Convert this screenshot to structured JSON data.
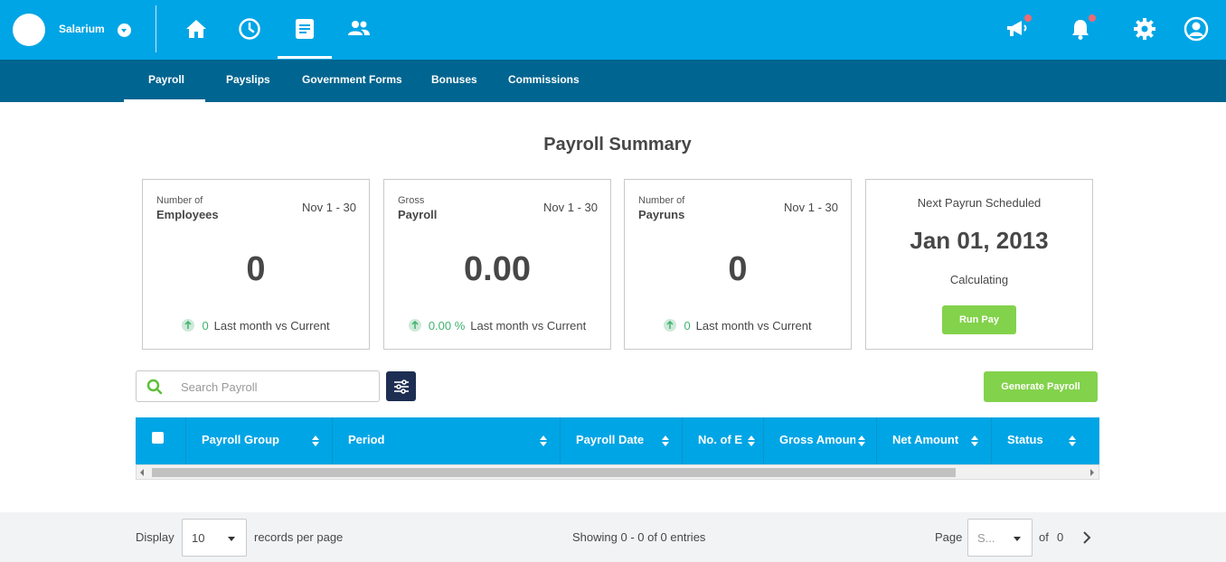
{
  "header": {
    "company_name": "Salarium",
    "nav_icons": [
      "home-icon",
      "clock-icon",
      "document-icon",
      "people-icon"
    ],
    "right_icons": [
      "megaphone-icon",
      "bell-icon",
      "gear-icon",
      "user-icon"
    ],
    "colors": {
      "primary": "#00a5e5",
      "secondary": "#006590",
      "accent_green": "#83d24b",
      "notification": "#ef6a73",
      "dark": "#1d2e52"
    }
  },
  "tabs": [
    {
      "label": "Payroll",
      "active": true
    },
    {
      "label": "Payslips"
    },
    {
      "label": "Government Forms"
    },
    {
      "label": "Bonuses"
    },
    {
      "label": "Commissions"
    }
  ],
  "page_title": "Payroll Summary",
  "cards": [
    {
      "small": "Number of",
      "label": "Employees",
      "range": "Nov 1 - 30",
      "value": "0",
      "change": "0",
      "footer": "Last month vs Current"
    },
    {
      "small": "Gross",
      "label": "Payroll",
      "range": "Nov 1 - 30",
      "value": "0.00",
      "change": "0.00 %",
      "footer": "Last month vs Current"
    },
    {
      "small": "Number of",
      "label": "Payruns",
      "range": "Nov 1 - 30",
      "value": "0",
      "change": "0",
      "footer": "Last month vs Current"
    }
  ],
  "next_payrun": {
    "title": "Next Payrun Scheduled",
    "date": "Jan 01, 2013",
    "status": "Calculating",
    "button": "Run Pay"
  },
  "search": {
    "placeholder": "Search Payroll"
  },
  "generate_button": "Generate Payroll",
  "table": {
    "columns": [
      "Payroll Group",
      "Period",
      "Payroll Date",
      "No. of E",
      "Gross Amoun",
      "Net Amount",
      "Status"
    ]
  },
  "footer": {
    "display_label": "Display",
    "page_size": "10",
    "records_label": "records per page",
    "showing": "Showing 0 - 0 of 0 entries",
    "page_label": "Page",
    "page_value": "S...",
    "of_label": "of",
    "total_pages": "0"
  }
}
